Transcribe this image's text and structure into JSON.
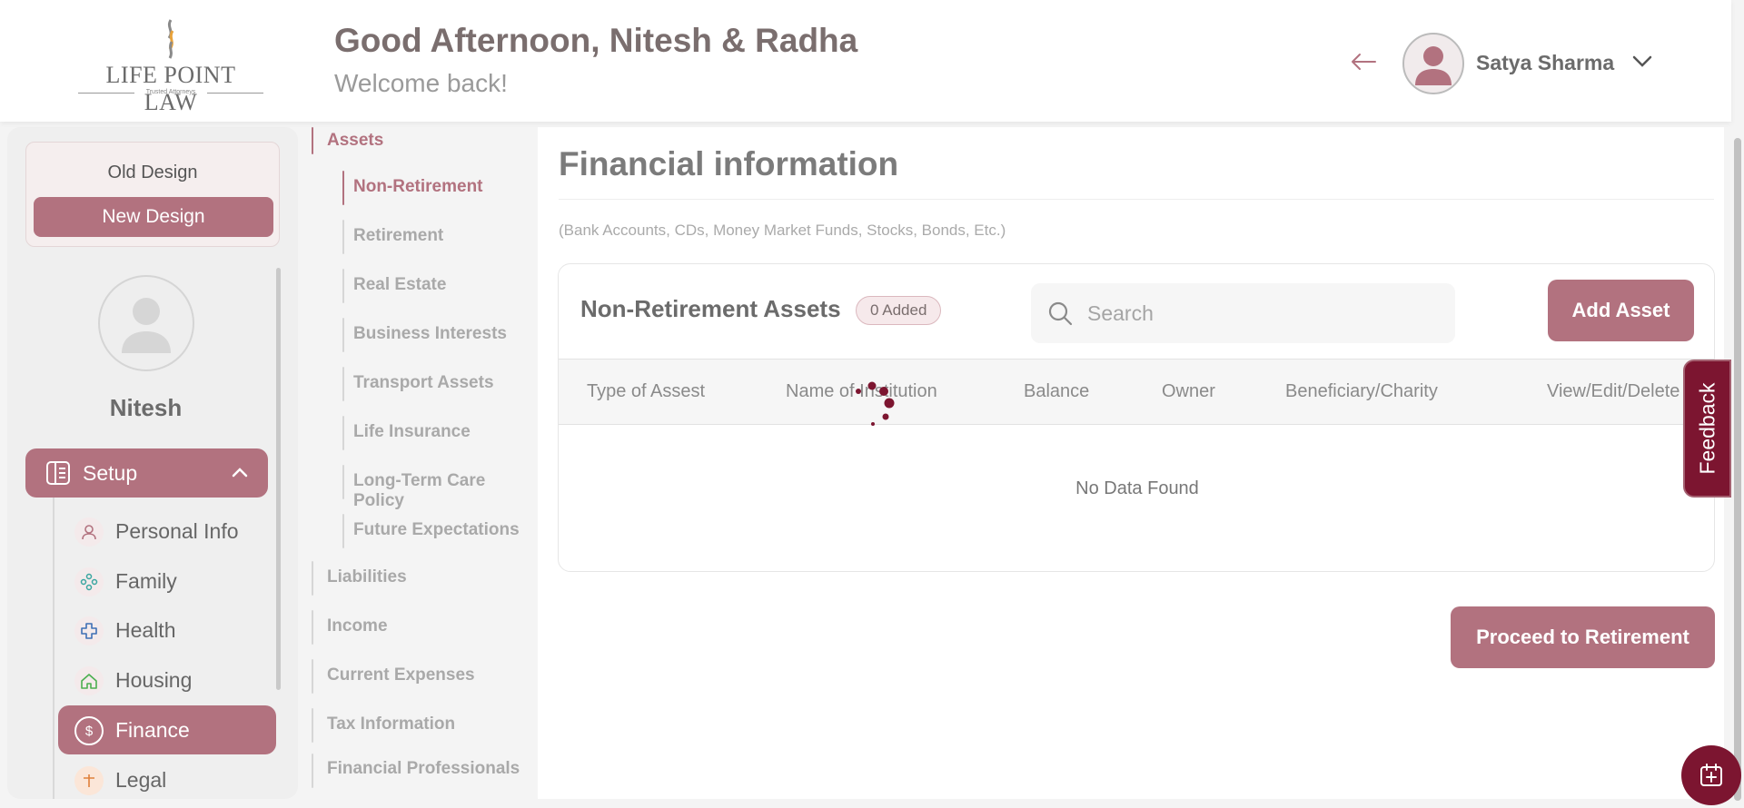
{
  "brand": {
    "logo_text": "LIFE POINT LAW",
    "logo_subtext": "Trusted Attorneys",
    "accent": "#b2727f",
    "dark_accent": "#7c1530"
  },
  "header": {
    "greeting": "Good Afternoon, Nitesh & Radha",
    "welcome": "Welcome back!",
    "user_name": "Satya Sharma"
  },
  "sidebar": {
    "old_design": "Old Design",
    "new_design": "New Design",
    "profile_name": "Nitesh",
    "setup_label": "Setup",
    "items": [
      {
        "label": "Personal Info",
        "icon": "person-icon"
      },
      {
        "label": "Family",
        "icon": "family-icon"
      },
      {
        "label": "Health",
        "icon": "health-cross-icon"
      },
      {
        "label": "Housing",
        "icon": "house-icon"
      },
      {
        "label": "Finance",
        "icon": "dollar-icon",
        "active": true
      },
      {
        "label": "Legal",
        "icon": "legal-icon"
      }
    ]
  },
  "subnav": {
    "assets": "Assets",
    "children": [
      "Non-Retirement",
      "Retirement",
      "Real Estate",
      "Business Interests",
      "Transport Assets",
      "Life Insurance",
      "Long-Term Care Policy",
      "Future Expectations"
    ],
    "sections": [
      "Liabilities",
      "Income",
      "Current Expenses",
      "Tax Information",
      "Financial Professionals"
    ]
  },
  "main": {
    "title": "Financial information",
    "subtitle": "(Bank Accounts, CDs, Money Market Funds, Stocks, Bonds, Etc.)",
    "card_title": "Non-Retirement Assets",
    "badge": "0 Added",
    "search_placeholder": "Search",
    "add_button": "Add Asset",
    "columns": [
      "Type of Assest",
      "Name of Institution",
      "Balance",
      "Owner",
      "Beneficiary/Charity",
      "View/Edit/Delete"
    ],
    "empty_text": "No Data Found",
    "proceed_button": "Proceed to Retirement"
  },
  "widgets": {
    "feedback": "Feedback"
  }
}
